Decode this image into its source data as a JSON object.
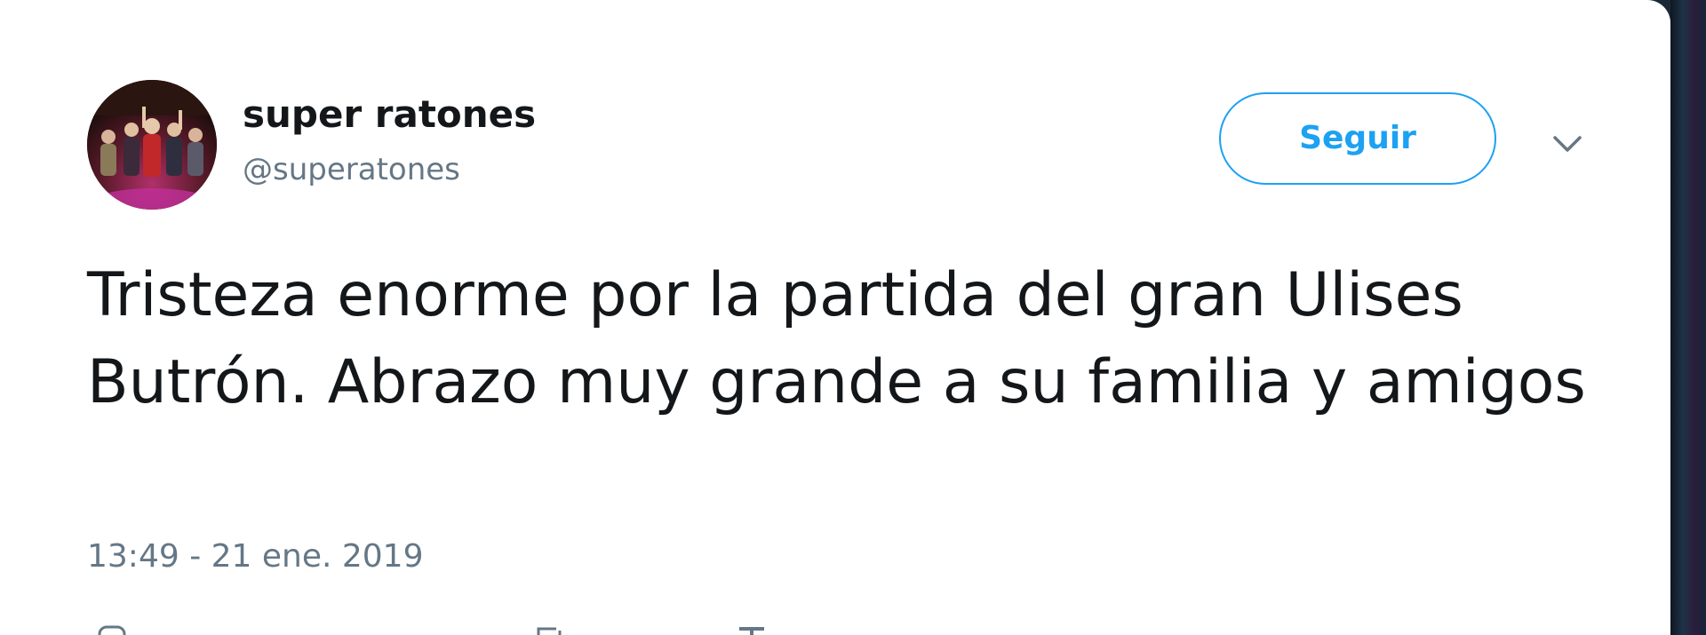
{
  "tweet": {
    "user_name": "super ratones",
    "user_handle": "@superatones",
    "follow_label": "Seguir",
    "text": "Tristeza enorme por la partida del gran Ulises Butrón. Abrazo muy grande a su familia y amigos",
    "timestamp": "13:49 - 21 ene. 2019"
  },
  "icons": {
    "caret": "chevron-down-icon",
    "actions": [
      "reply-icon",
      "retweet-icon",
      "like-icon"
    ]
  },
  "colors": {
    "accent": "#1da1f2",
    "text_primary": "#14171a",
    "text_secondary": "#657786",
    "background": "#ffffff"
  }
}
